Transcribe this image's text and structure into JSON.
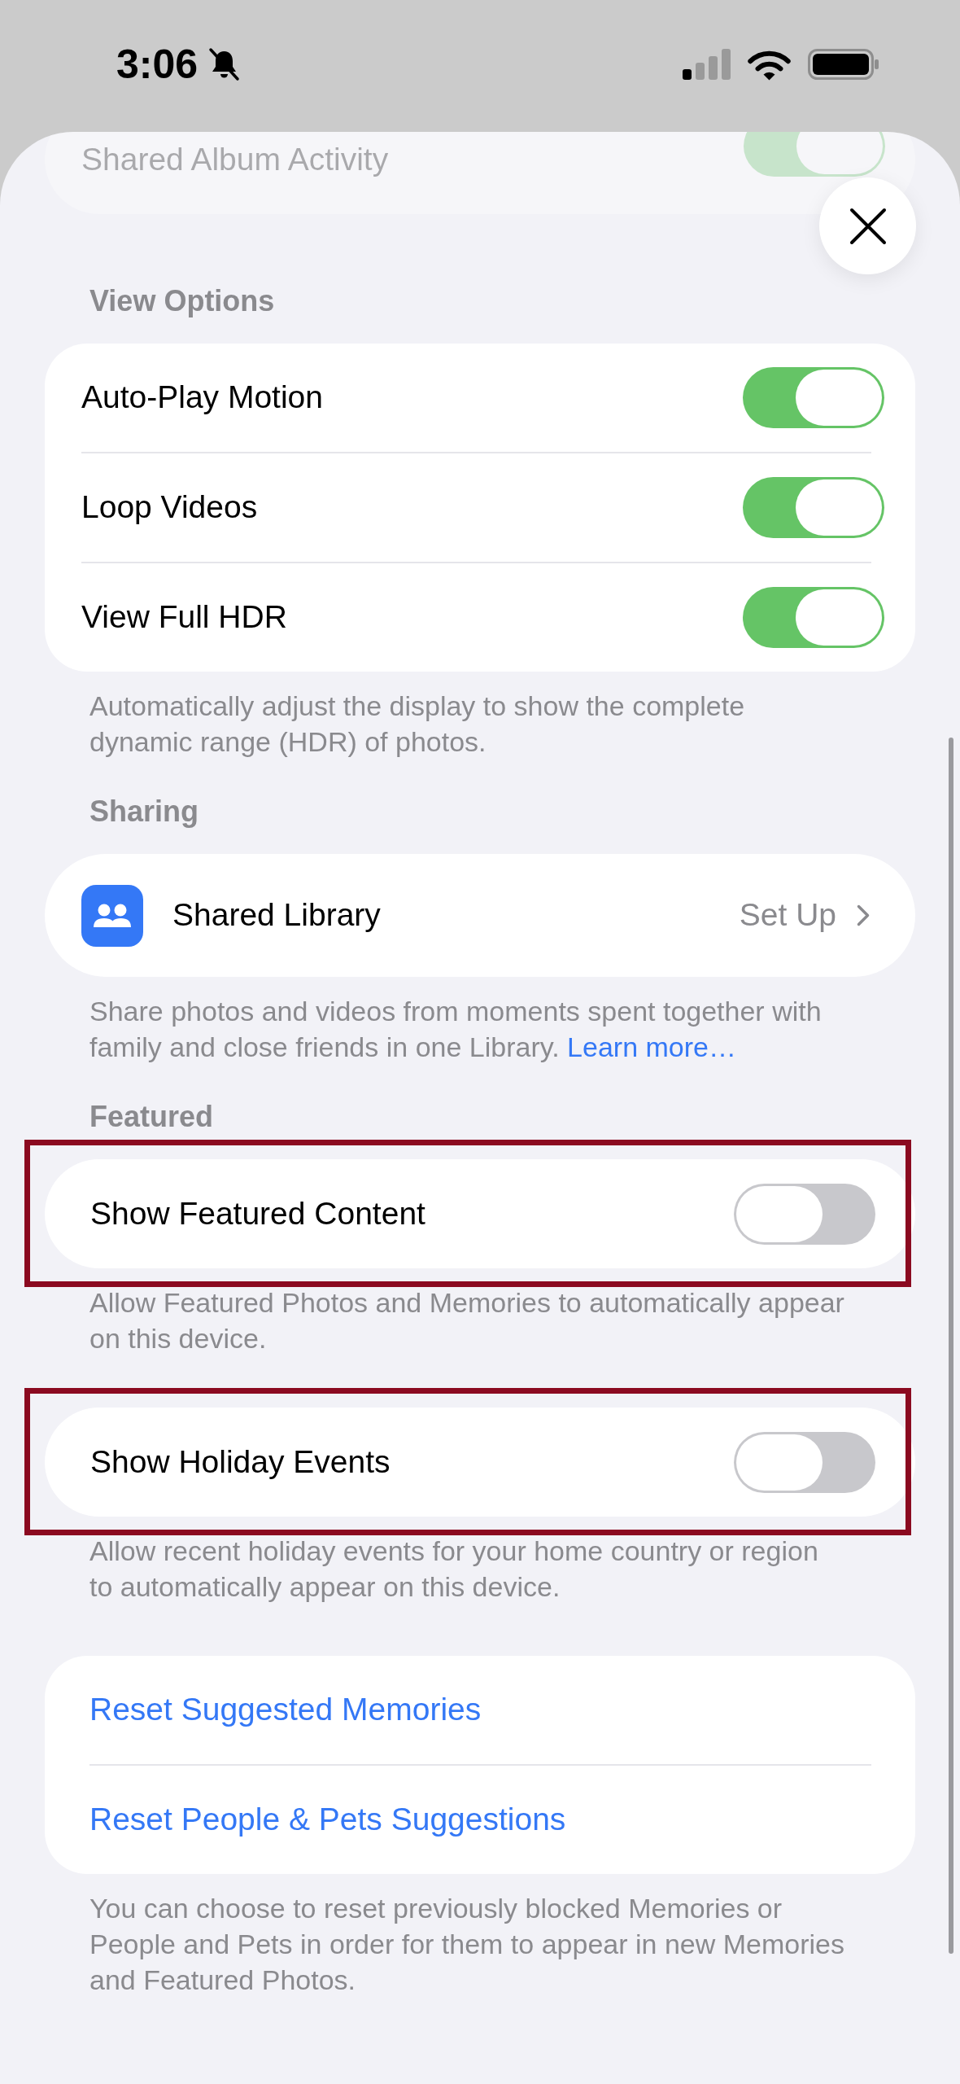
{
  "status_bar": {
    "time": "3:06",
    "silent": true
  },
  "top_row": {
    "label": "Shared Album Activity",
    "on": true
  },
  "sections": [
    {
      "header": "View Options",
      "highlighted": false,
      "rows": [
        {
          "kind": "toggle",
          "label": "Auto-Play Motion",
          "on": true
        },
        {
          "kind": "toggle",
          "label": "Loop Videos",
          "on": true
        },
        {
          "kind": "toggle",
          "label": "View Full HDR",
          "on": true
        }
      ],
      "footer": "Automatically adjust the display to show the complete dynamic range (HDR) of photos."
    },
    {
      "header": "Sharing",
      "highlighted": false,
      "rows": [
        {
          "kind": "link",
          "label": "Shared Library",
          "value": "Set Up"
        }
      ],
      "footer": "Share photos and videos from moments spent together with family and close friends in one Library.",
      "footer_link": "Learn more…"
    },
    {
      "header": "Featured",
      "highlighted": true,
      "rows": [
        {
          "kind": "toggle",
          "label": "Show Featured Content",
          "on": false
        }
      ],
      "footer": "Allow Featured Photos and Memories to automatically appear on this device."
    },
    {
      "highlighted": true,
      "rows": [
        {
          "kind": "toggle",
          "label": "Show Holiday Events",
          "on": false
        }
      ],
      "footer": "Allow recent holiday events for your home country or region to automatically appear on this device."
    },
    {
      "highlighted": false,
      "rows": [
        {
          "kind": "action",
          "label": "Reset Suggested Memories"
        },
        {
          "kind": "action",
          "label": "Reset People & Pets Suggestions"
        }
      ],
      "footer": "You can choose to reset previously blocked Memories or People and Pets in order for them to appear in new Memories and Featured Photos."
    }
  ]
}
